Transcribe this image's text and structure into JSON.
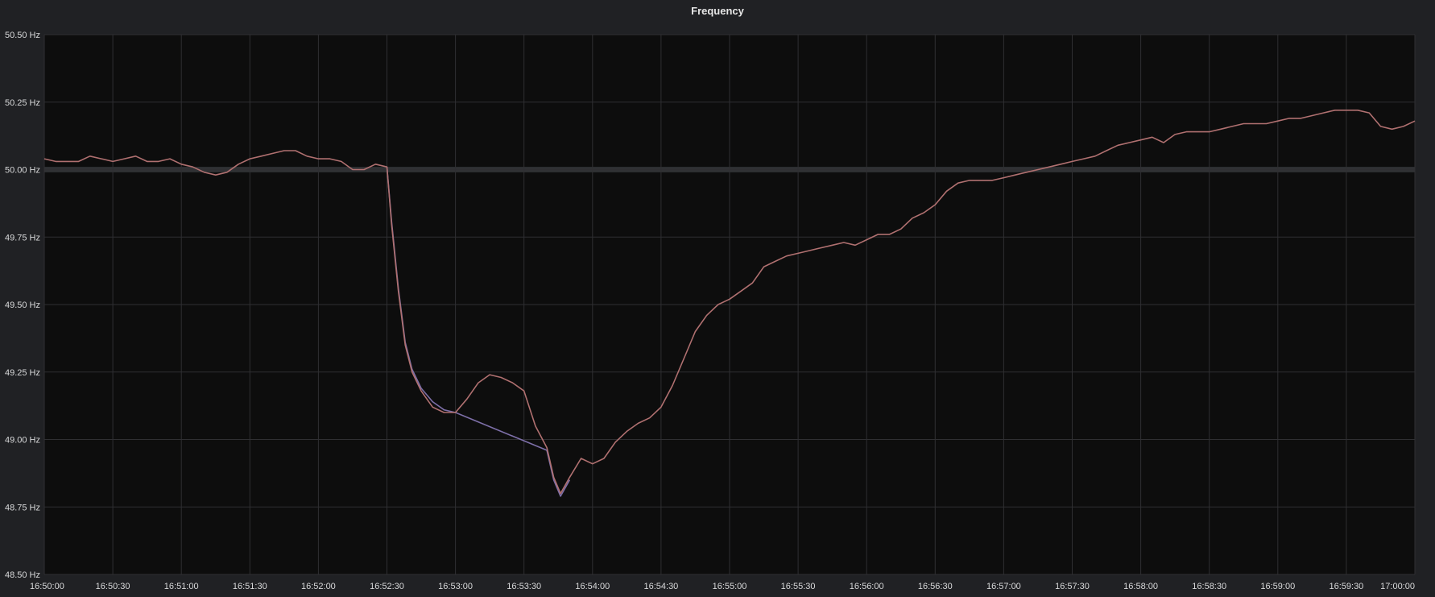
{
  "panel": {
    "title": "Frequency"
  },
  "chart_data": {
    "type": "line",
    "title": "Frequency",
    "xlabel": "",
    "ylabel": "",
    "x_range": [
      "16:50:00",
      "17:00:00"
    ],
    "ylim": [
      48.5,
      50.5
    ],
    "y_ticks": [
      "48.50 Hz",
      "48.75 Hz",
      "49.00 Hz",
      "49.25 Hz",
      "49.50 Hz",
      "49.75 Hz",
      "50.00 Hz",
      "50.25 Hz",
      "50.50 Hz"
    ],
    "x_ticks": [
      "16:50:00",
      "16:50:30",
      "16:51:00",
      "16:51:30",
      "16:52:00",
      "16:52:30",
      "16:53:00",
      "16:53:30",
      "16:54:00",
      "16:54:30",
      "16:55:00",
      "16:55:30",
      "16:56:00",
      "16:56:30",
      "16:57:00",
      "16:57:30",
      "16:58:00",
      "16:58:30",
      "16:59:00",
      "16:59:30",
      "17:00:00"
    ],
    "grid": true,
    "threshold_band": [
      49.99,
      50.01
    ],
    "colors": {
      "background": "#202124",
      "plot_background": "#0d0d0d",
      "grid": "#2f2f32",
      "series_primary": "#b07070",
      "series_secondary": "#7d6fa8",
      "band": "#3a3b3e"
    },
    "series": [
      {
        "color": "#b07070",
        "x": [
          "16:50:00",
          "16:50:05",
          "16:50:10",
          "16:50:15",
          "16:50:20",
          "16:50:25",
          "16:50:30",
          "16:50:35",
          "16:50:40",
          "16:50:45",
          "16:50:50",
          "16:50:55",
          "16:51:00",
          "16:51:05",
          "16:51:10",
          "16:51:15",
          "16:51:20",
          "16:51:25",
          "16:51:30",
          "16:51:35",
          "16:51:40",
          "16:51:45",
          "16:51:50",
          "16:51:55",
          "16:52:00",
          "16:52:05",
          "16:52:10",
          "16:52:15",
          "16:52:20",
          "16:52:25",
          "16:52:30",
          "16:52:32",
          "16:52:35",
          "16:52:38",
          "16:52:41",
          "16:52:45",
          "16:52:50",
          "16:52:55",
          "16:53:00",
          "16:53:05",
          "16:53:10",
          "16:53:15",
          "16:53:20",
          "16:53:25",
          "16:53:30",
          "16:53:35",
          "16:53:40",
          "16:53:43",
          "16:53:46",
          "16:53:50",
          "16:53:55",
          "16:54:00",
          "16:54:05",
          "16:54:10",
          "16:54:15",
          "16:54:20",
          "16:54:25",
          "16:54:30",
          "16:54:35",
          "16:54:40",
          "16:54:45",
          "16:54:50",
          "16:54:55",
          "16:55:00",
          "16:55:05",
          "16:55:10",
          "16:55:15",
          "16:55:20",
          "16:55:25",
          "16:55:30",
          "16:55:35",
          "16:55:40",
          "16:55:45",
          "16:55:50",
          "16:55:55",
          "16:56:00",
          "16:56:05",
          "16:56:10",
          "16:56:15",
          "16:56:20",
          "16:56:25",
          "16:56:30",
          "16:56:35",
          "16:56:40",
          "16:56:45",
          "16:56:50",
          "16:56:55",
          "16:57:00",
          "16:57:05",
          "16:57:10",
          "16:57:15",
          "16:57:20",
          "16:57:25",
          "16:57:30",
          "16:57:35",
          "16:57:40",
          "16:57:45",
          "16:57:50",
          "16:57:55",
          "16:58:00",
          "16:58:05",
          "16:58:10",
          "16:58:15",
          "16:58:20",
          "16:58:25",
          "16:58:30",
          "16:58:35",
          "16:58:40",
          "16:58:45",
          "16:58:50",
          "16:58:55",
          "16:59:00",
          "16:59:05",
          "16:59:10",
          "16:59:15",
          "16:59:20",
          "16:59:25",
          "16:59:30",
          "16:59:35",
          "16:59:40",
          "16:59:45",
          "16:59:50",
          "16:59:55",
          "17:00:00"
        ],
        "values": [
          50.04,
          50.03,
          50.03,
          50.03,
          50.05,
          50.04,
          50.03,
          50.04,
          50.05,
          50.03,
          50.03,
          50.04,
          50.02,
          50.01,
          49.99,
          49.98,
          49.99,
          50.02,
          50.04,
          50.05,
          50.06,
          50.07,
          50.07,
          50.05,
          50.04,
          50.04,
          50.03,
          50.0,
          50.0,
          50.02,
          50.01,
          49.8,
          49.55,
          49.35,
          49.25,
          49.18,
          49.12,
          49.1,
          49.1,
          49.15,
          49.21,
          49.24,
          49.23,
          49.21,
          49.18,
          49.05,
          48.97,
          48.86,
          48.8,
          48.86,
          48.93,
          48.91,
          48.93,
          48.99,
          49.03,
          49.06,
          49.08,
          49.12,
          49.2,
          49.3,
          49.4,
          49.46,
          49.5,
          49.52,
          49.55,
          49.58,
          49.64,
          49.66,
          49.68,
          49.69,
          49.7,
          49.71,
          49.72,
          49.73,
          49.72,
          49.74,
          49.76,
          49.76,
          49.78,
          49.82,
          49.84,
          49.87,
          49.92,
          49.95,
          49.96,
          49.96,
          49.96,
          49.97,
          49.98,
          49.99,
          50.0,
          50.01,
          50.02,
          50.03,
          50.04,
          50.05,
          50.07,
          50.09,
          50.1,
          50.11,
          50.12,
          50.1,
          50.13,
          50.14,
          50.14,
          50.14,
          50.15,
          50.16,
          50.17,
          50.17,
          50.17,
          50.18,
          50.19,
          50.19,
          50.2,
          50.21,
          50.22,
          50.22,
          50.22,
          50.21,
          50.16,
          50.15,
          50.16,
          50.18
        ]
      },
      {
        "color": "#7d6fa8",
        "x": [
          "16:52:30",
          "16:52:32",
          "16:52:35",
          "16:52:38",
          "16:52:41",
          "16:52:45",
          "16:52:50",
          "16:52:55",
          "16:53:00",
          "16:53:40",
          "16:53:43",
          "16:53:46",
          "16:53:50"
        ],
        "values": [
          50.01,
          49.81,
          49.56,
          49.36,
          49.26,
          49.19,
          49.14,
          49.11,
          49.1,
          48.96,
          48.85,
          48.79,
          48.85
        ]
      }
    ]
  }
}
